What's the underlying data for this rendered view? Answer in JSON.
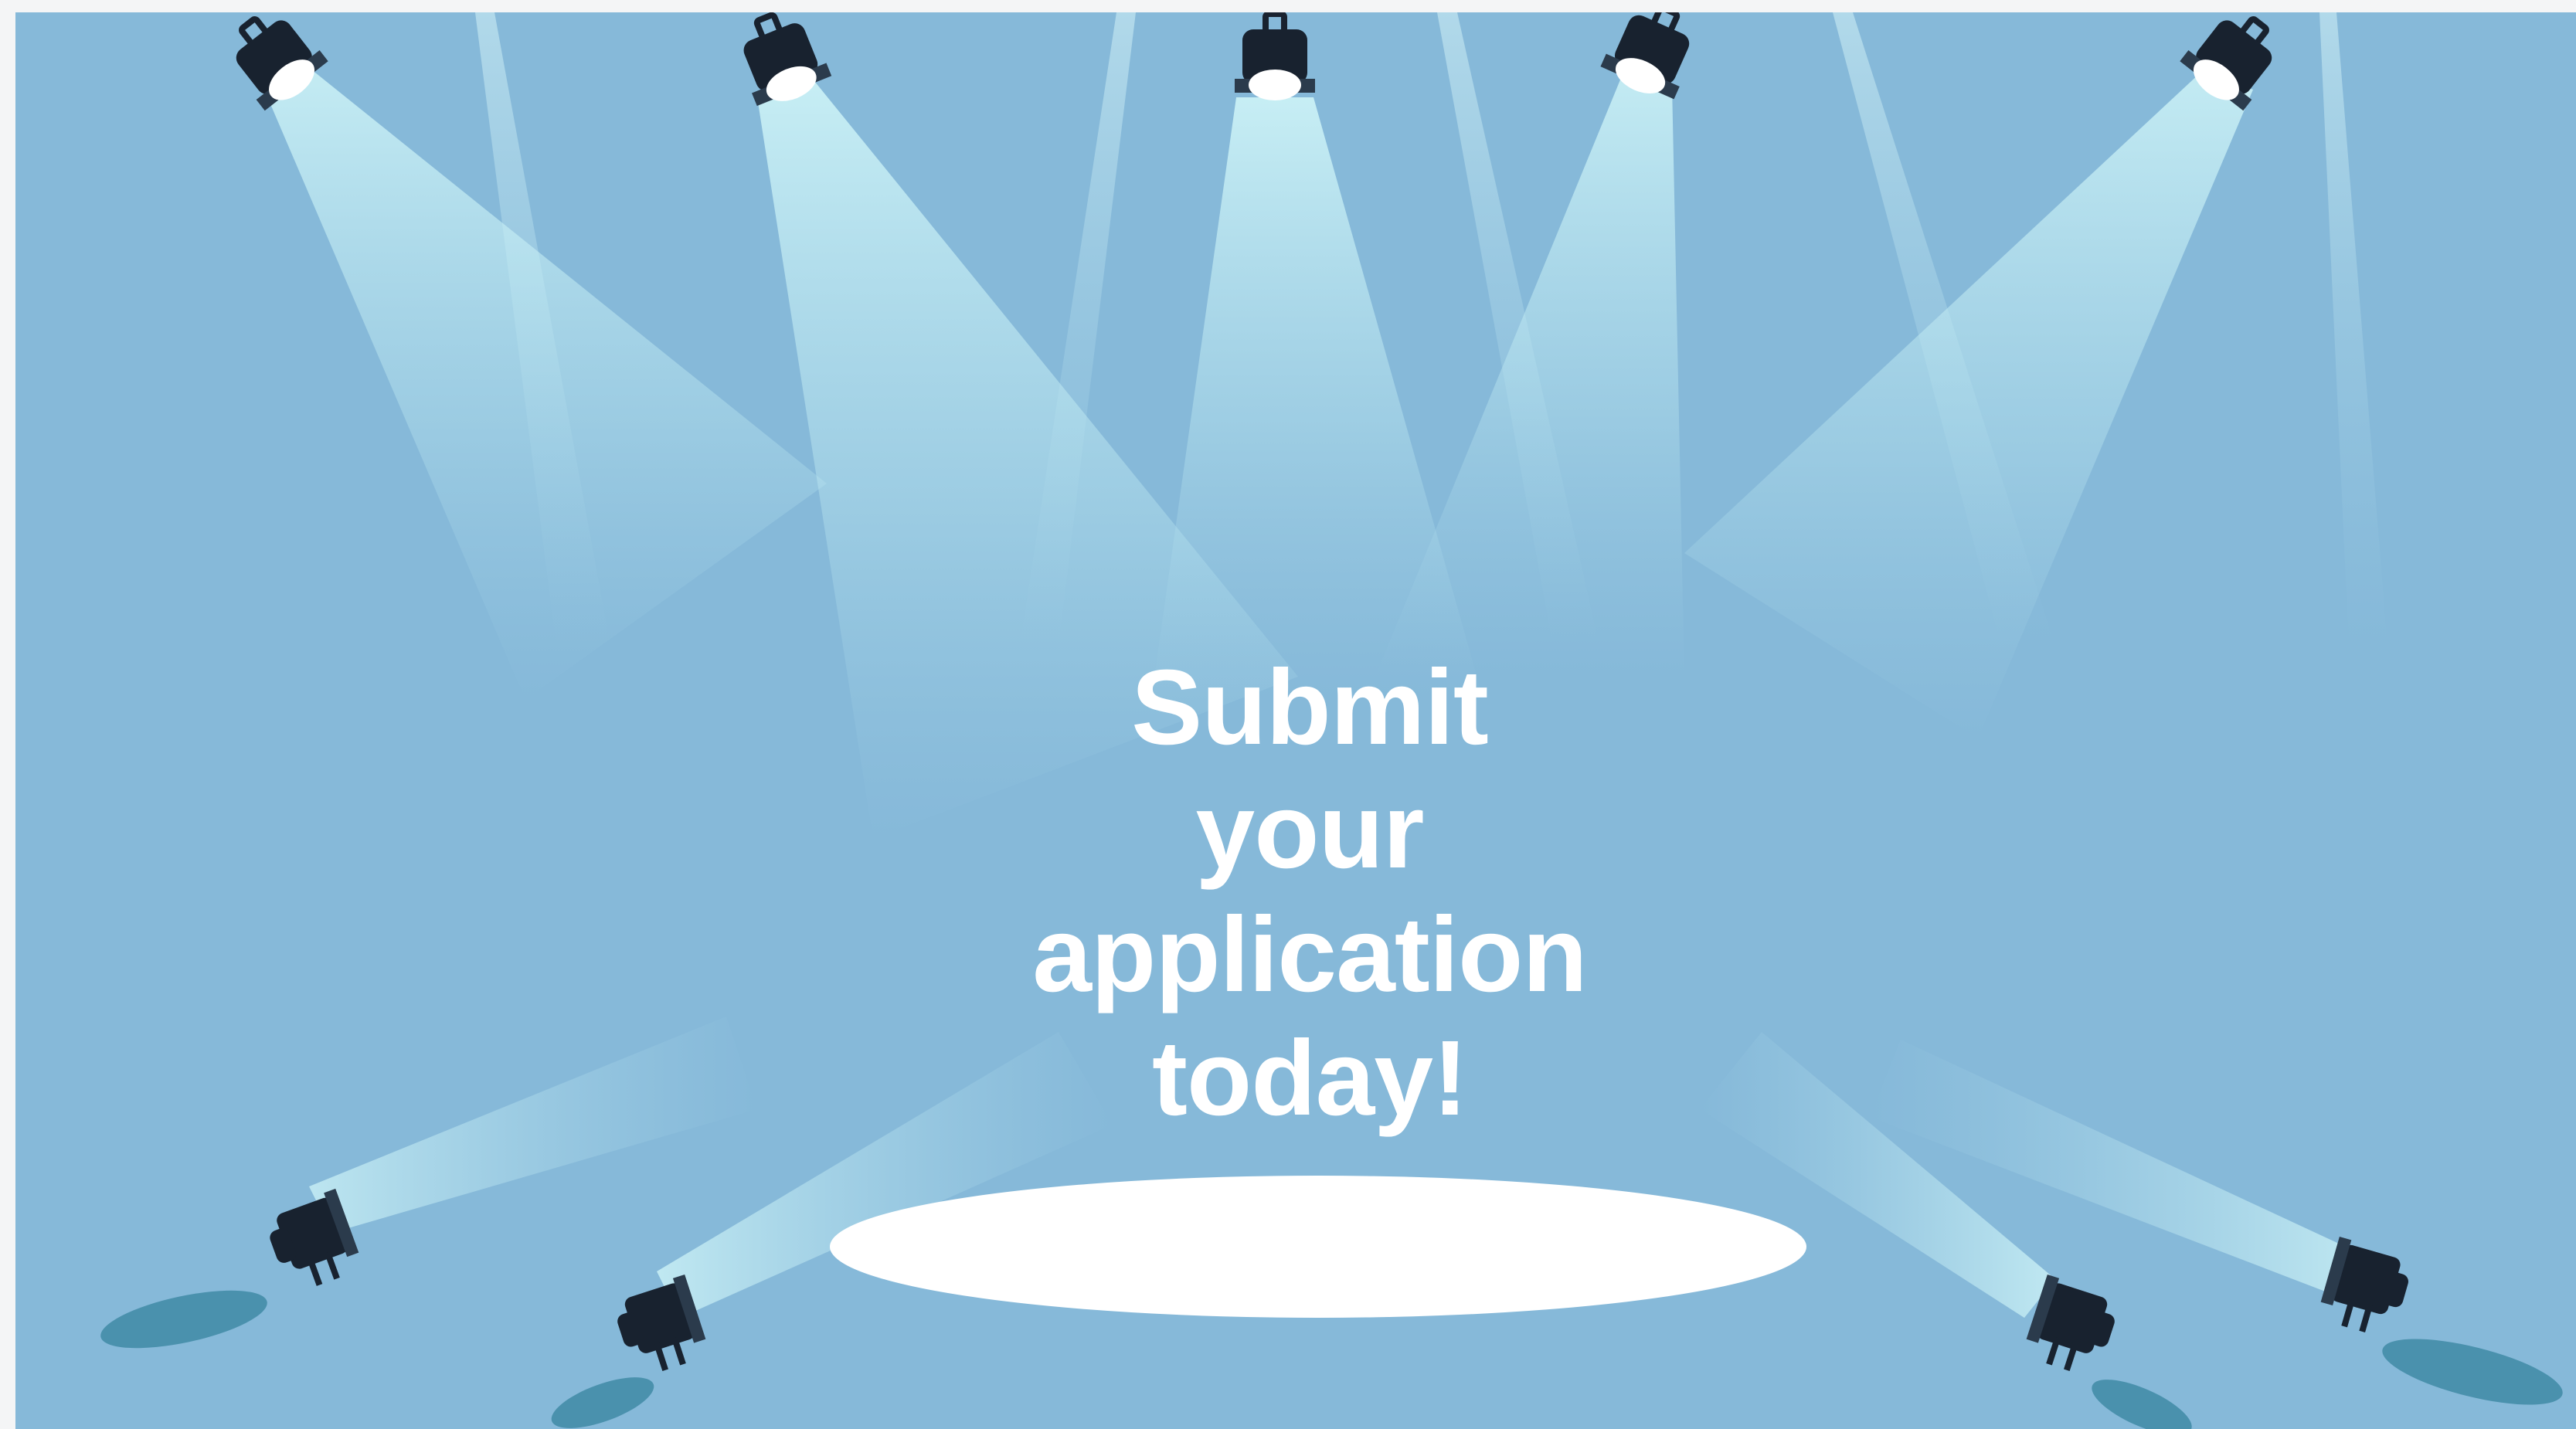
{
  "slide": {
    "headline_lines": [
      "Submit",
      "your",
      "application",
      "today!"
    ]
  },
  "colors": {
    "background": "#86b9d9",
    "beam": "#c9f3f7",
    "spotlight_pool": "#ffffff",
    "fixture": "#18222f",
    "shadow": "#4a91ad",
    "text": "#ffffff"
  },
  "icons": {
    "top_lights": "spotlight-icon",
    "floor_lights": "spotlight-icon"
  }
}
